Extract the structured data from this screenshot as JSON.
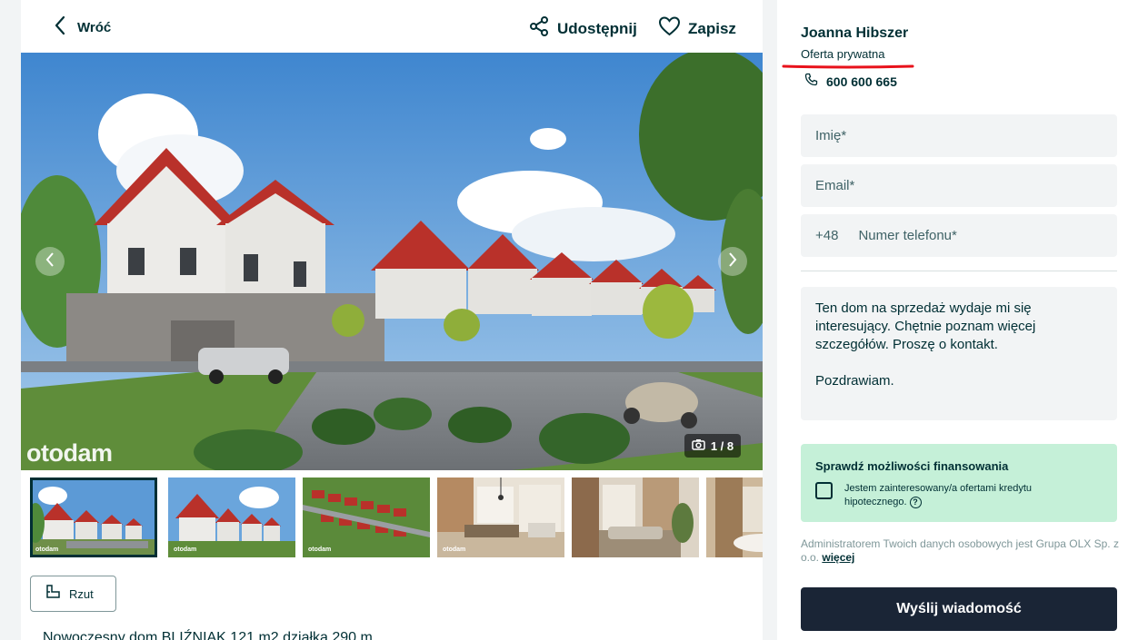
{
  "header": {
    "back_label": "Wróć",
    "share_label": "Udostępnij",
    "save_label": "Zapisz"
  },
  "gallery": {
    "watermark": "otodam",
    "counter": "1 / 8",
    "thumbnail_count": 6,
    "active_thumbnail": 1
  },
  "floorplan_button": "Rzut",
  "description_title": "Nowoczesny dom BLIŹNIAK 121 m2 działka 290 m",
  "seller": {
    "name": "Joanna Hibszer",
    "type": "Oferta prywatna",
    "phone": "600 600 665"
  },
  "form": {
    "name_placeholder": "Imię*",
    "email_placeholder": "Email*",
    "phone_prefix": "+48",
    "phone_placeholder": "Numer telefonu*",
    "message_lines": [
      "Ten dom na sprzedaż wydaje mi się interesujący. Chętnie poznam więcej szczegółów. Proszę o kontakt.",
      "Pozdrawiam."
    ]
  },
  "financing": {
    "title": "Sprawdź możliwości finansowania",
    "checkbox_label": "Jestem zainteresowany/a ofertami kredytu hipotecznego.",
    "checked": false
  },
  "admin_note": {
    "text": "Administratorem Twoich danych osobowych jest Grupa OLX Sp. z o.o.",
    "more": "więcej"
  },
  "send_button": "Wyślij wiadomość",
  "colors": {
    "primary_dark": "#002f34",
    "button_dark": "#1a2536",
    "finance_bg": "#c5f0d8",
    "input_bg": "#f2f4f5",
    "highlight_red": "#e8121b"
  }
}
